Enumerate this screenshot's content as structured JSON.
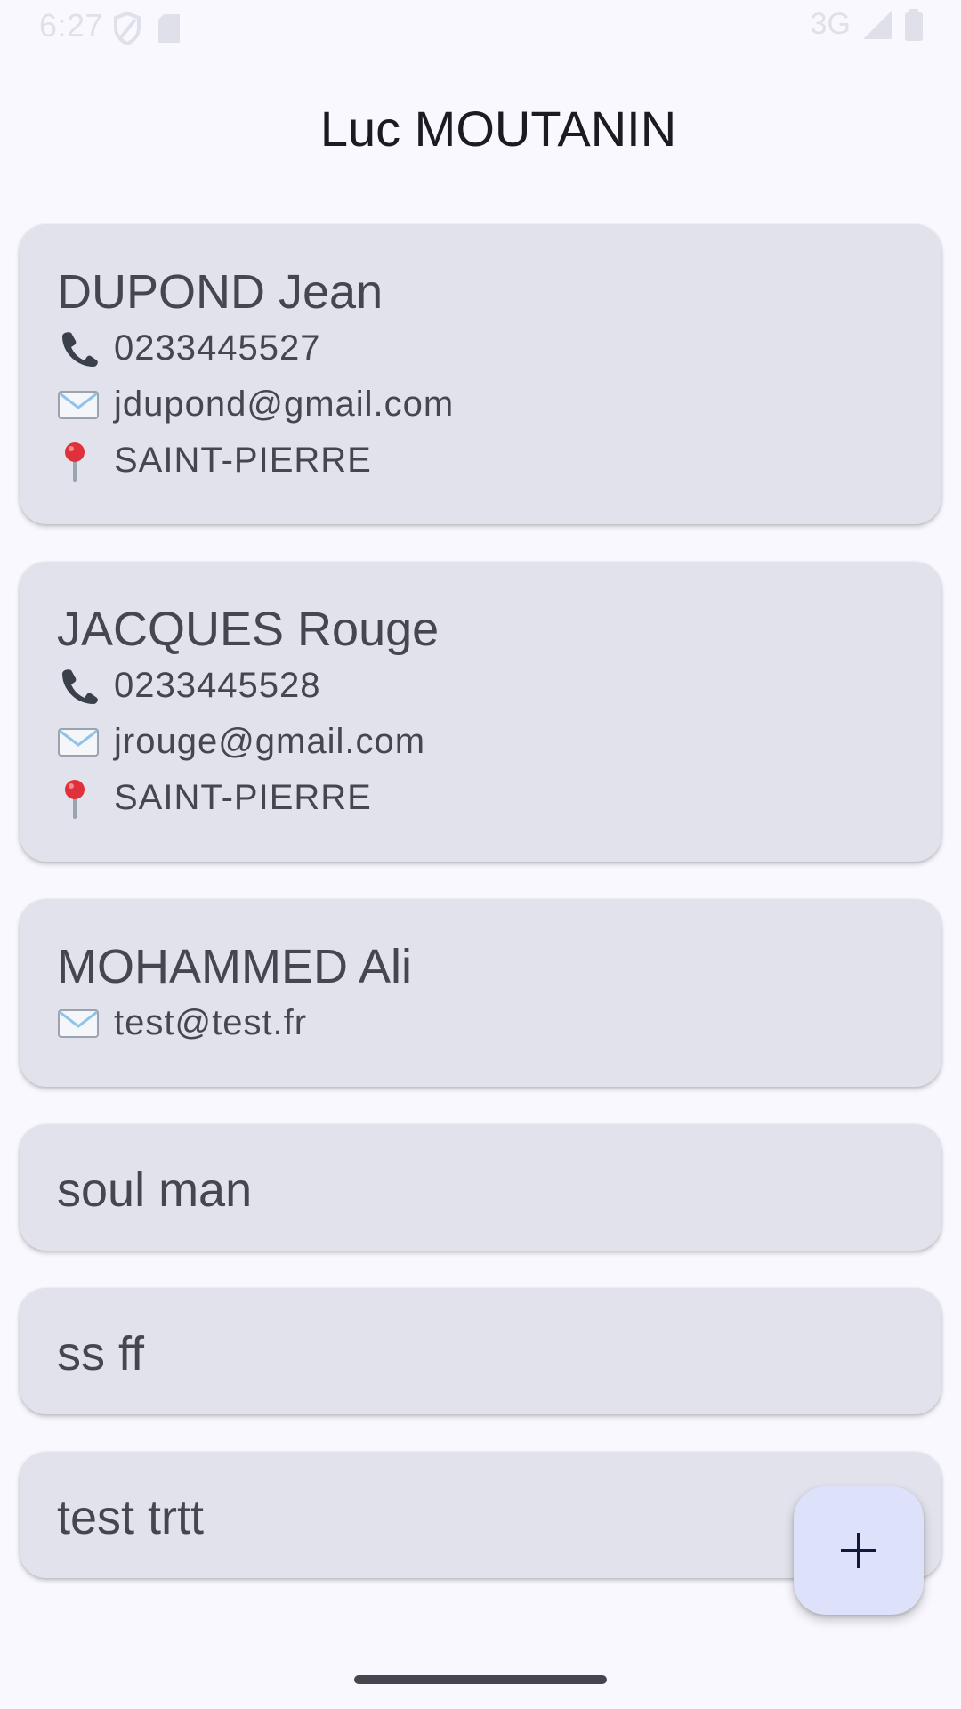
{
  "status_bar": {
    "time": "6:27",
    "network": "3G"
  },
  "app": {
    "title": "Luc MOUTANIN"
  },
  "contacts": [
    {
      "name": "DUPOND Jean",
      "phone": "0233445527",
      "email": "jdupond@gmail.com",
      "city": "SAINT-PIERRE"
    },
    {
      "name": "JACQUES Rouge",
      "phone": "0233445528",
      "email": "jrouge@gmail.com",
      "city": "SAINT-PIERRE"
    },
    {
      "name": "MOHAMMED Ali",
      "email": "test@test.fr"
    },
    {
      "name": "soul man"
    },
    {
      "name": "ss ff"
    },
    {
      "name": "test trtt"
    }
  ],
  "icons": {
    "phone": "phone-icon",
    "email": "envelope-icon",
    "city": "map-pin-icon",
    "fab": "plus-icon"
  },
  "colors": {
    "background": "#f8f8fe",
    "card": "#e2e2ec",
    "fab": "#dde1f9",
    "text": "#45464f"
  }
}
